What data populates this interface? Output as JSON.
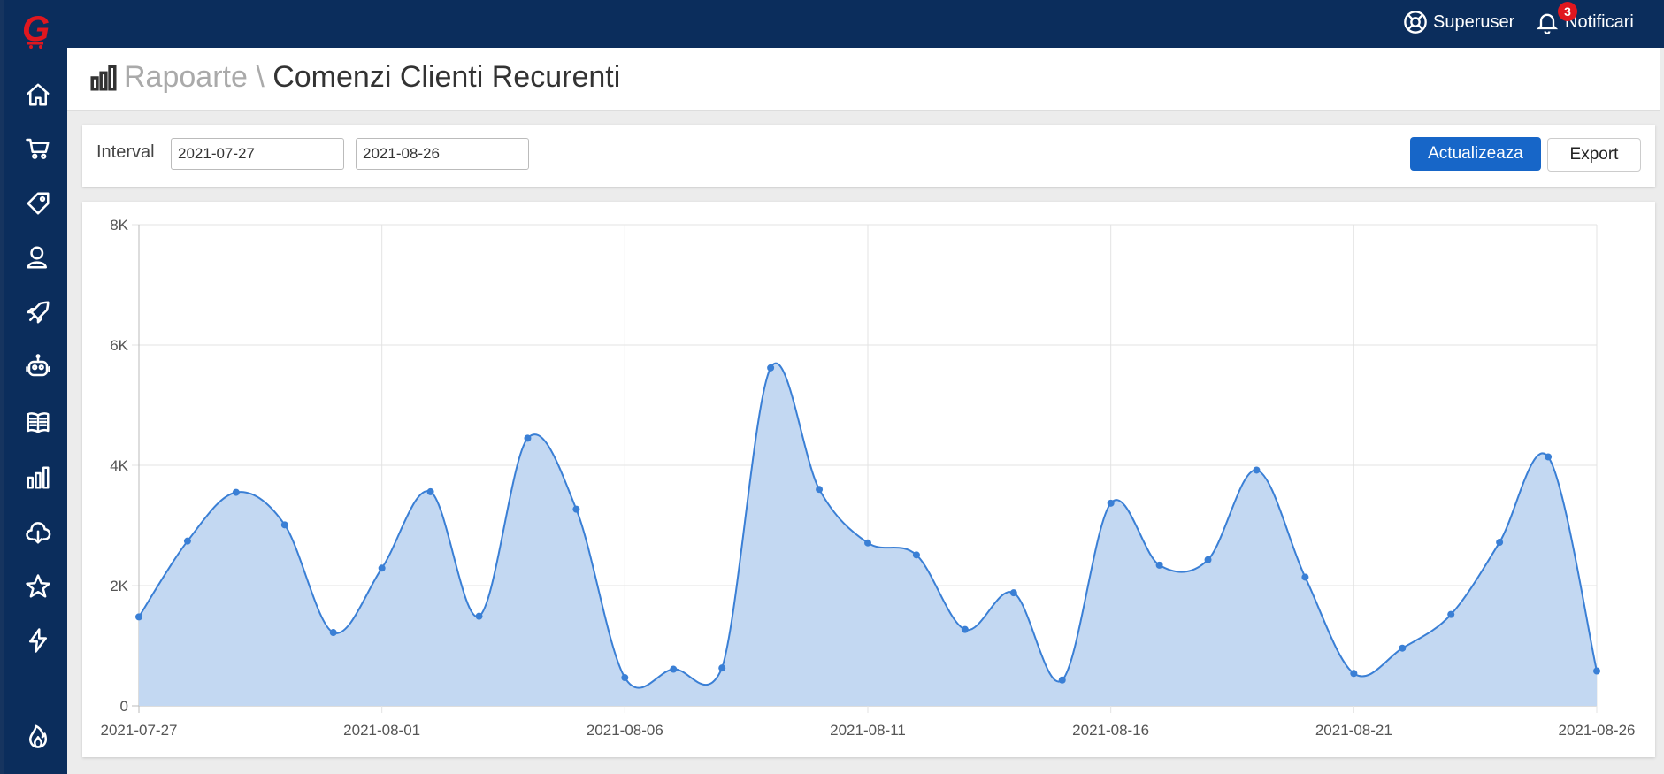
{
  "app": {
    "brand_color": "#0b2d5c",
    "logo_letter": "G",
    "logo_color": "#e0171f"
  },
  "sidebar": {
    "items": [
      {
        "icon": "home-icon"
      },
      {
        "icon": "cart-icon"
      },
      {
        "icon": "tag-icon"
      },
      {
        "icon": "customers-icon"
      },
      {
        "icon": "rocket-icon"
      },
      {
        "icon": "robot-icon"
      },
      {
        "icon": "book-icon"
      },
      {
        "icon": "reports-icon"
      },
      {
        "icon": "cloud-download-icon"
      },
      {
        "icon": "star-icon"
      },
      {
        "icon": "lightning-icon"
      },
      {
        "icon": "fire-icon"
      }
    ]
  },
  "topbar": {
    "user_label": "Superuser",
    "notifications_label": "Notificari",
    "notifications_count": "3"
  },
  "header": {
    "crumb": "Rapoarte \\",
    "title": "Comenzi Clienti Recurenti"
  },
  "filters": {
    "interval_label": "Interval",
    "date_from": "2021-07-27",
    "date_to": "2021-08-26",
    "update_label": "Actualizeaza",
    "export_label": "Export"
  },
  "chart_data": {
    "type": "area",
    "title": "",
    "xlabel": "",
    "ylabel": "",
    "ylim": [
      0,
      8000
    ],
    "y_ticks": [
      "0",
      "2K",
      "4K",
      "6K",
      "8K"
    ],
    "x_tick_labels": [
      "2021-07-27",
      "2021-08-01",
      "2021-08-06",
      "2021-08-11",
      "2021-08-16",
      "2021-08-21",
      "2021-08-26"
    ],
    "grid": true,
    "line_color": "#3a7fd5",
    "fill_color": "#c3d8f2",
    "x": [
      "2021-07-27",
      "2021-07-28",
      "2021-07-29",
      "2021-07-30",
      "2021-07-31",
      "2021-08-01",
      "2021-08-02",
      "2021-08-03",
      "2021-08-04",
      "2021-08-05",
      "2021-08-06",
      "2021-08-07",
      "2021-08-08",
      "2021-08-09",
      "2021-08-10",
      "2021-08-11",
      "2021-08-12",
      "2021-08-13",
      "2021-08-14",
      "2021-08-15",
      "2021-08-16",
      "2021-08-17",
      "2021-08-18",
      "2021-08-19",
      "2021-08-20",
      "2021-08-21",
      "2021-08-22",
      "2021-08-23",
      "2021-08-24",
      "2021-08-25",
      "2021-08-26"
    ],
    "series": [
      {
        "values": [
          1480,
          2740,
          3550,
          3010,
          1220,
          2290,
          3560,
          1490,
          4450,
          3270,
          470,
          610,
          630,
          5620,
          3600,
          2710,
          2510,
          1270,
          1880,
          430,
          3370,
          2340,
          2430,
          3920,
          2140,
          540,
          960,
          1520,
          2720,
          4140,
          580
        ]
      }
    ]
  }
}
